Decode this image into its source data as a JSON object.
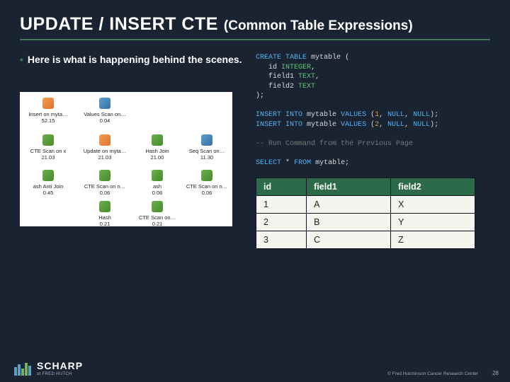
{
  "title": {
    "main": "UPDATE / INSERT CTE",
    "sub": "(Common Table Expressions)"
  },
  "bullet": "Here is what is happening behind the scenes.",
  "code": {
    "create_kw": "CREATE TABLE",
    "tbl_name": "mytable",
    "open": "(",
    "col1": "id",
    "type1": "INTEGER",
    "col2": "field1",
    "type2": "TEXT",
    "col3": "field2",
    "type3": "TEXT",
    "close": ");",
    "insert_kw": "INSERT INTO",
    "values_kw": "VALUES",
    "null_kw": "NULL",
    "row1": "(1, NULL, NULL);",
    "row2": "(2, NULL, NULL);",
    "v1": "1",
    "v2": "2",
    "comment": "-- Run Command from the Previous Page",
    "select_kw": "SELECT",
    "star": "*",
    "from_kw": "FROM",
    "semi": ";"
  },
  "table": {
    "headers": [
      "id",
      "field1",
      "field2"
    ],
    "rows": [
      [
        "1",
        "A",
        "X"
      ],
      [
        "2",
        "B",
        "Y"
      ],
      [
        "3",
        "C",
        "Z"
      ]
    ]
  },
  "plan": {
    "n0": {
      "label": "Insert on myta…",
      "cost": "52.15"
    },
    "n1": {
      "label": "Values Scan on…",
      "cost": "0.04"
    },
    "n2": {
      "label": "CTE Scan on x",
      "cost": "21.03"
    },
    "n3": {
      "label": "Update on myta…",
      "cost": "21.03"
    },
    "n4": {
      "label": "Hash Join",
      "cost": "21.00"
    },
    "n5": {
      "label": "Seq Scan on…",
      "cost": "11.30"
    },
    "n6": {
      "label": "ash Anti Join",
      "cost": "0.45"
    },
    "n7": {
      "label": "CTE Scan on n…",
      "cost": "0.06"
    },
    "n8": {
      "label": "ash",
      "cost": "0.06"
    },
    "n9": {
      "label": "CTE Scan on n…",
      "cost": "0.06"
    },
    "n10": {
      "label": "Hash",
      "cost": "0.21"
    },
    "n11": {
      "label": "CTE Scan on…",
      "cost": "0.21"
    }
  },
  "footer": {
    "logo": "SCHARP",
    "tag": "at FRED HUTCH",
    "copyright": "© Fred Hutchinson Cancer Research Center",
    "page": "28"
  }
}
